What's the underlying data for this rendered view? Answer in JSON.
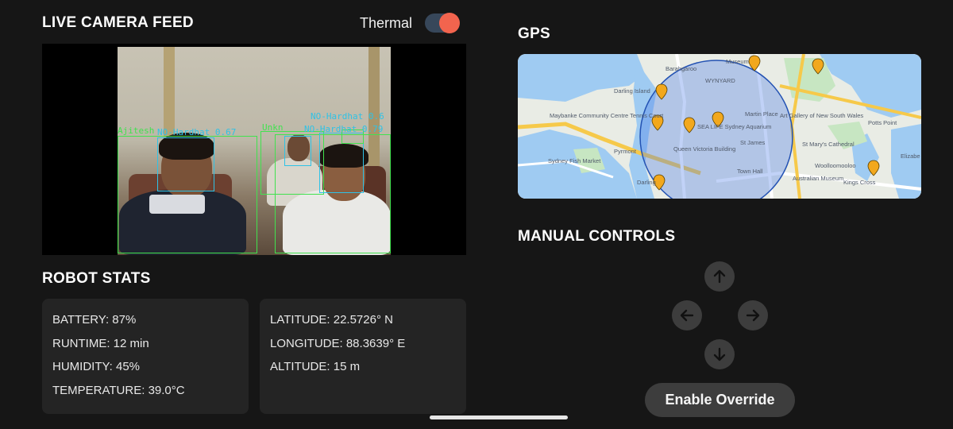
{
  "camera": {
    "title": "LIVE CAMERA FEED",
    "thermal_label": "Thermal",
    "thermal_on": true,
    "detections": [
      {
        "label": "Ajitesh",
        "color": "#41e24f"
      },
      {
        "label": "NO-Hardhat 0.67",
        "color": "#2fc2e6"
      },
      {
        "label": "Unkn",
        "color": "#41e24f"
      },
      {
        "label": "NO-Hardhat 0.6",
        "color": "#2fc2e6"
      },
      {
        "label": "NO-Hardhat 0.79",
        "color": "#2fc2e6"
      }
    ]
  },
  "stats": {
    "title": "ROBOT STATS",
    "left": [
      "BATTERY: 87%",
      "RUNTIME: 12 min",
      "HUMIDITY: 45%",
      "TEMPERATURE: 39.0°C"
    ],
    "right": [
      "LATITUDE: 22.5726° N",
      "LONGITUDE: 88.3639° E",
      "ALTITUDE: 15 m"
    ]
  },
  "gps": {
    "title": "GPS",
    "map_labels": {
      "barahgaroo": "Barahgaroo",
      "wynyard": "WYNYARD",
      "darling_island": "Darling Island",
      "pyrmont": "Pyrmont",
      "potts_point": "Potts Point",
      "elizabeth": "Elizabe",
      "woolloomooloo": "Woolloomooloo",
      "st_james": "St James",
      "town_hall": "Town Hall",
      "australian_museum": "Australian Museum",
      "kings_cross": "Kings Cross",
      "darling": "Darling",
      "martin_place": "Martin Place",
      "sydney_fish_market": "Sydney Fish Market",
      "maybanke": "Maybanke Community Centre Tennis Court",
      "sea_life": "SEA LIFE Sydney Aquarium",
      "qvb": "Queen Victoria Building",
      "art_gallery": "Art Gallery of New South Wales",
      "st_marys": "St Mary's Cathedral",
      "museum": "Museum"
    }
  },
  "controls": {
    "title": "MANUAL CONTROLS",
    "override_label": "Enable Override",
    "icons": [
      "arrow-up-icon",
      "arrow-left-icon",
      "arrow-right-icon",
      "arrow-down-icon"
    ]
  },
  "colors": {
    "accent": "#f2644e",
    "background": "#161616",
    "card": "#242424",
    "button": "#3d3d3d"
  }
}
